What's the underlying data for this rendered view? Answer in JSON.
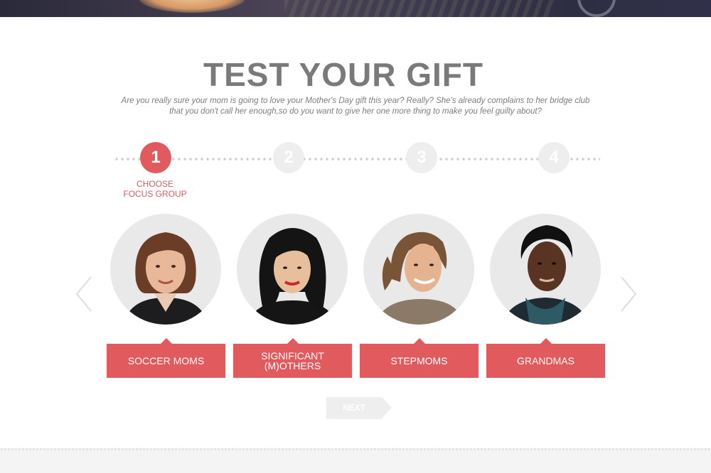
{
  "page": {
    "title": "TEST YOUR GIFT",
    "subtitle_line1": "Are you really sure your mom is going to love your Mother's Day gift this year? Really? She's already complains to her bridge club",
    "subtitle_line2": "that you don't call her enough,so do you want to give her one more thing to make you feel guilty about?"
  },
  "steps": {
    "items": [
      {
        "number": "1",
        "state": "active"
      },
      {
        "number": "2",
        "state": "inactive"
      },
      {
        "number": "3",
        "state": "inactive"
      },
      {
        "number": "4",
        "state": "inactive"
      }
    ],
    "active_label_line1": "CHOOSE",
    "active_label_line2": "FOCUS GROUP"
  },
  "carousel": {
    "prev_icon": "chevron-left-icon",
    "next_icon": "chevron-right-icon",
    "groups": [
      {
        "label_line1": "SOCCER MOMS",
        "label_line2": ""
      },
      {
        "label_line1": "SIGNIFICANT",
        "label_line2": "(M)OTHERS"
      },
      {
        "label_line1": "STEPMOMS",
        "label_line2": ""
      },
      {
        "label_line1": "GRANDMAS",
        "label_line2": ""
      }
    ]
  },
  "actions": {
    "next_label": "NEXT"
  },
  "colors": {
    "accent": "#e05a5e",
    "title_gray": "#7a7a7a",
    "inactive_gray": "#eeeeee"
  }
}
